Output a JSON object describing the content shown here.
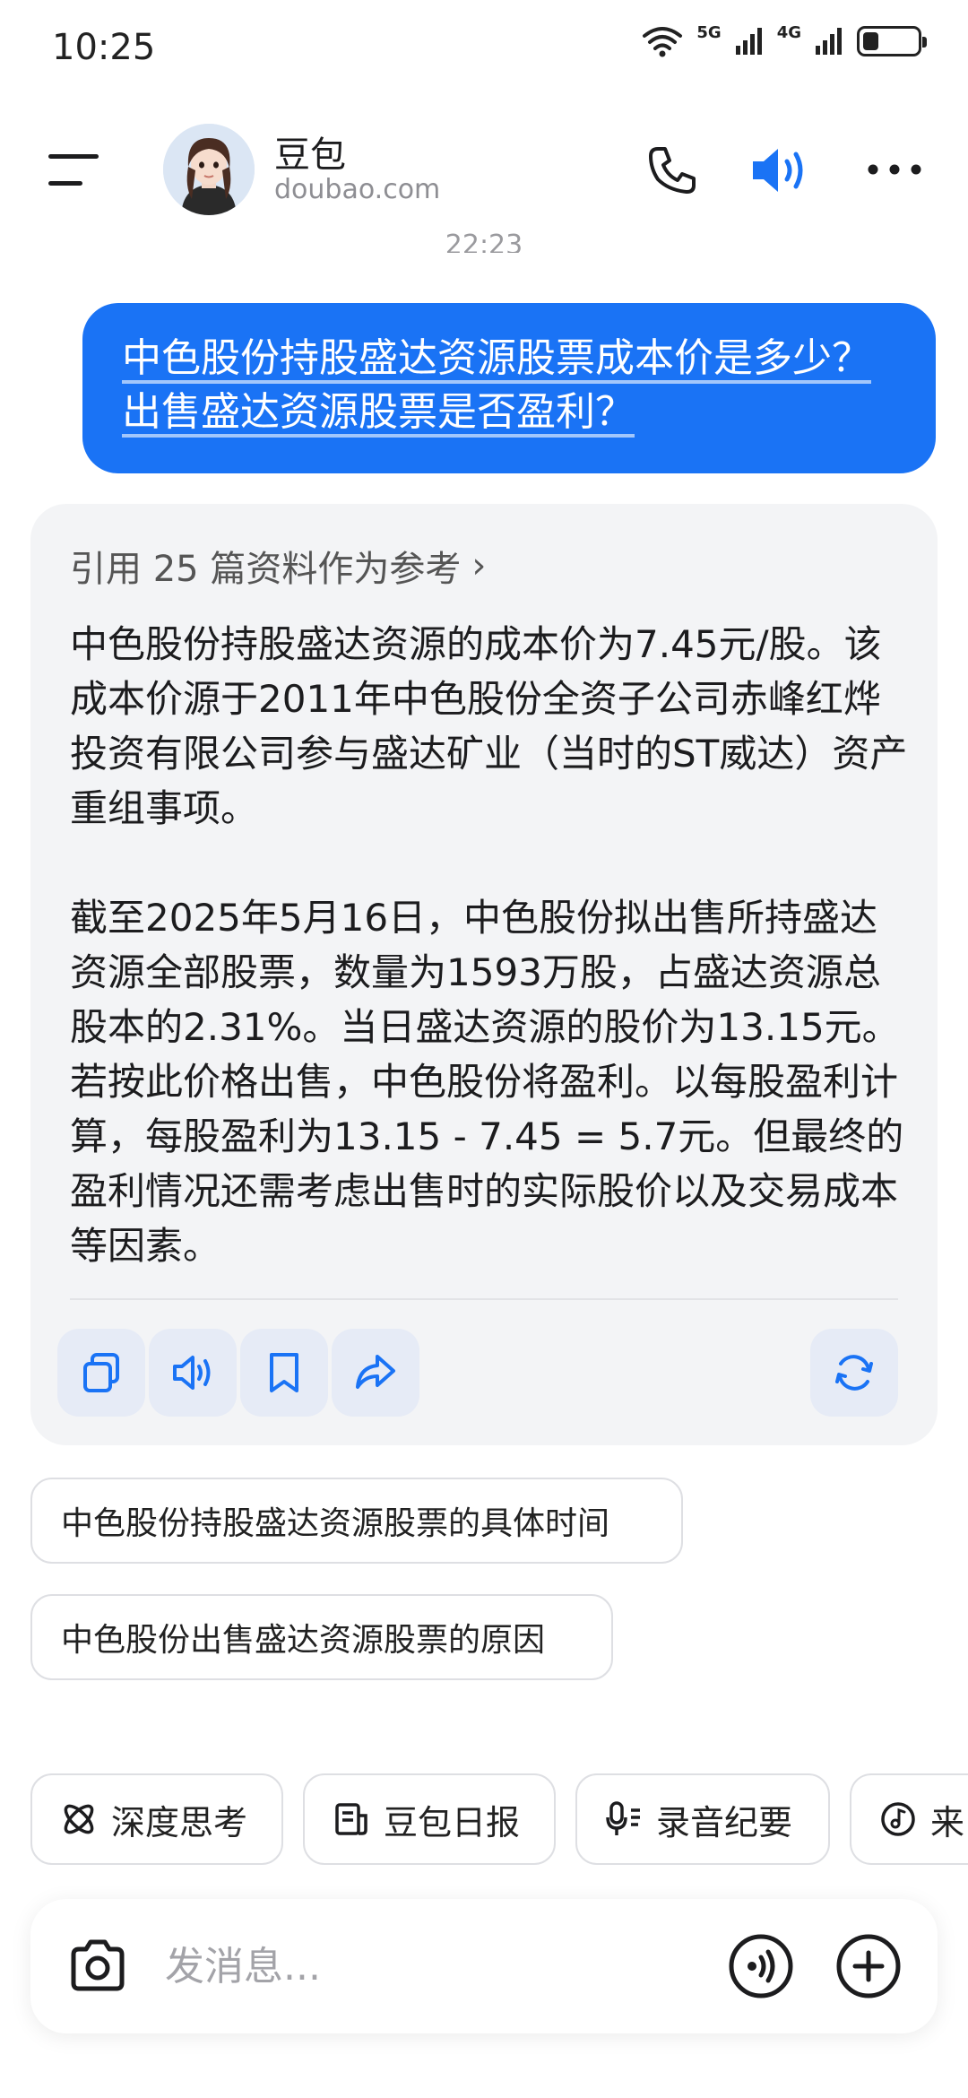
{
  "status_bar": {
    "time": "10:25",
    "signal_1_label": "5G",
    "signal_2_label": "4G",
    "battery_level": 0.3
  },
  "header": {
    "bot_name": "豆包",
    "bot_domain": "doubao.com",
    "avatar_icon": "avatar-girl",
    "menu_icon": "menu-icon",
    "phone_icon": "phone-icon",
    "speaker_icon": "speaker-icon",
    "more_icon": "more-icon",
    "accent_color": "#1a73f5"
  },
  "chat": {
    "timestamp": "22:23",
    "user_message": "中色股份持股盛达资源股票成本价是多少？出售盛达资源股票是否盈利？",
    "reference_label": "引用 25 篇资料作为参考",
    "reference_chevron": "›",
    "answer_paragraph_1": "中色股份持股盛达资源的成本价为7.45元/股。该成本价源于2011年中色股份全资子公司赤峰红烨投资有限公司参与盛达矿业（当时的ST威达）资产重组事项。",
    "answer_paragraph_2": "截至2025年5月16日，中色股份拟出售所持盛达资源全部股票，数量为1593万股，占盛达资源总股本的2.31%。当日盛达资源的股价为13.15元。若按此价格出售，中色股份将盈利。以每股盈利计算，每股盈利为13.15 - 7.45 = 5.7元。但最终的盈利情况还需考虑出售时的实际股价以及交易成本等因素。",
    "actions": [
      "copy-icon",
      "read-aloud-icon",
      "bookmark-icon",
      "share-icon",
      "regenerate-icon"
    ]
  },
  "suggestions": [
    "中色股份持股盛达资源股票的具体时间",
    "中色股份出售盛达资源股票的原因"
  ],
  "quick_actions": [
    {
      "label": "深度思考",
      "icon": "deep-think-icon"
    },
    {
      "label": "豆包日报",
      "icon": "daily-report-icon"
    },
    {
      "label": "录音纪要",
      "icon": "recording-icon"
    },
    {
      "label": "来",
      "icon": "music-icon"
    }
  ],
  "input": {
    "placeholder": "发消息...",
    "value": ""
  }
}
